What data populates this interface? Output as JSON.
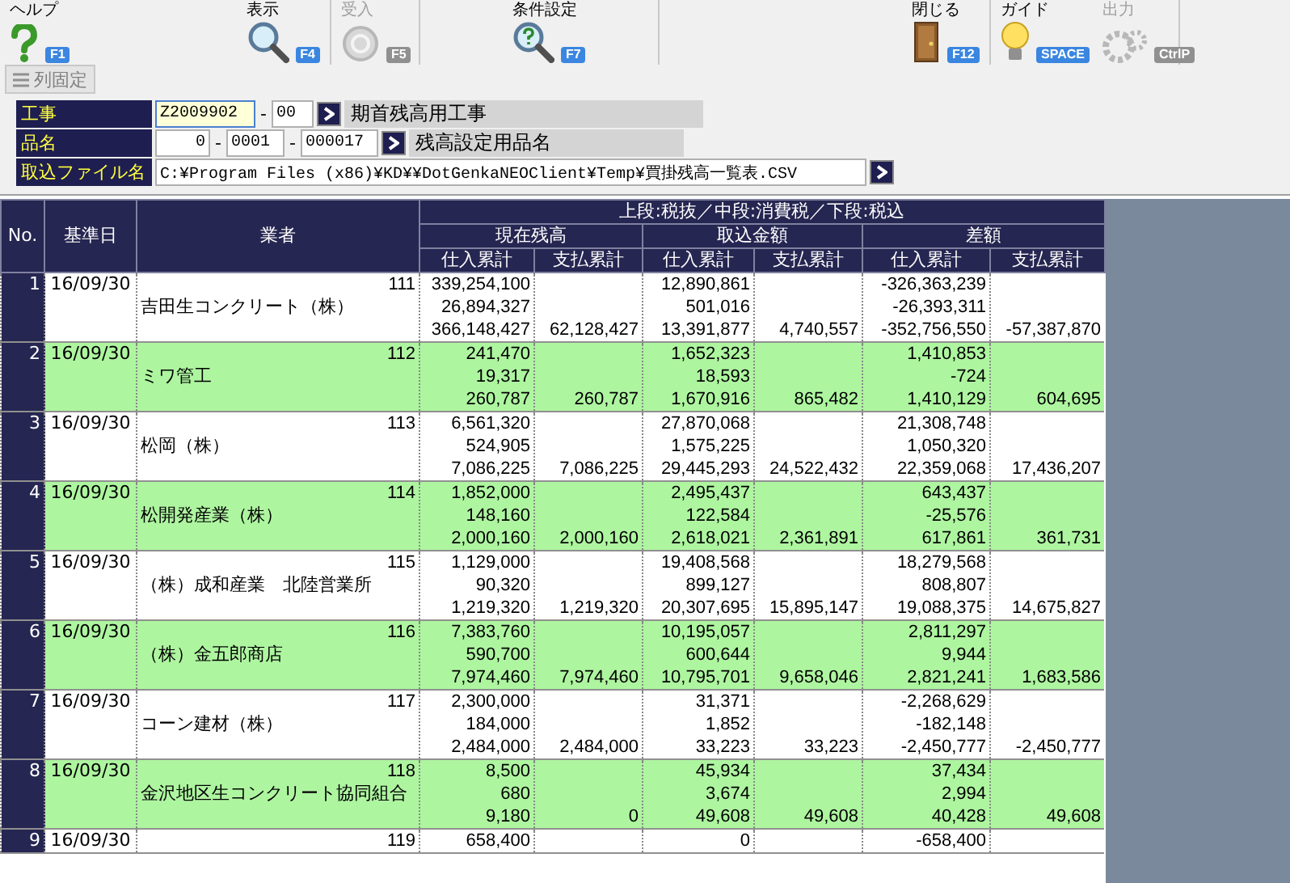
{
  "toolbar": {
    "groups": [
      {
        "items": [
          {
            "label": "ヘルプ",
            "key": "F1",
            "disabled": false
          },
          {
            "label": "表示",
            "key": "F4",
            "disabled": false
          }
        ]
      },
      {
        "items": [
          {
            "label": "受入",
            "key": "F5",
            "disabled": true
          }
        ]
      },
      {
        "items": [
          {
            "label": "条件設定",
            "key": "F7",
            "disabled": false
          }
        ]
      },
      {
        "items": [
          {
            "label": "閉じる",
            "key": "F12",
            "disabled": false
          }
        ]
      },
      {
        "items": [
          {
            "label": "ガイド",
            "key": "SPACE",
            "disabled": false
          },
          {
            "label": "出力",
            "key": "CtrlP",
            "disabled": true
          }
        ]
      }
    ]
  },
  "freeze_button": {
    "label": "列固定",
    "disabled": true
  },
  "filters": [
    {
      "label": "工事",
      "parts": [
        {
          "kind": "input",
          "value": "Z2009902",
          "focused": true
        },
        {
          "kind": "sep",
          "text": "-"
        },
        {
          "kind": "input",
          "value": "00",
          "focused": false
        },
        {
          "kind": "lookup"
        },
        {
          "kind": "display",
          "text": "期首残高用工事"
        }
      ]
    },
    {
      "label": "品名",
      "parts": [
        {
          "kind": "input",
          "value": "0",
          "focused": false
        },
        {
          "kind": "sep",
          "text": "-"
        },
        {
          "kind": "input",
          "value": "0001",
          "focused": false
        },
        {
          "kind": "sep",
          "text": "-"
        },
        {
          "kind": "input",
          "value": "000017",
          "focused": false
        },
        {
          "kind": "lookup"
        },
        {
          "kind": "display",
          "text": "残高設定用品名"
        }
      ]
    },
    {
      "label": "取込ファイル名",
      "parts": [
        {
          "kind": "input",
          "value": "C:¥Program Files (x86)¥KD¥¥DotGenkaNEOClient¥Temp¥買掛残高一覧表.CSV",
          "focused": false
        },
        {
          "kind": "lookup"
        }
      ]
    }
  ],
  "table": {
    "columns": {
      "no": "No.",
      "date": "基準日",
      "vendor": "業者",
      "tier_note": "上段:税抜／中段:消費税／下段:税込",
      "groups": [
        {
          "label": "現在残高",
          "sub": [
            "仕入累計",
            "支払累計"
          ]
        },
        {
          "label": "取込金額",
          "sub": [
            "仕入累計",
            "支払累計"
          ]
        },
        {
          "label": "差額",
          "sub": [
            "仕入累計",
            "支払累計"
          ]
        }
      ]
    },
    "rows": [
      {
        "no": "1",
        "date": "16/09/30",
        "code": "111",
        "name": "吉田生コンクリート（株）",
        "cells": [
          {
            "upper": "339,254,100",
            "middle": "26,894,327",
            "lower": "366,148,427"
          },
          {
            "lower": "62,128,427"
          },
          {
            "upper": "12,890,861",
            "middle": "501,016",
            "lower": "13,391,877"
          },
          {
            "lower": "4,740,557"
          },
          {
            "upper": "-326,363,239",
            "middle": "-26,393,311",
            "lower": "-352,756,550"
          },
          {
            "lower": "-57,387,870"
          }
        ]
      },
      {
        "no": "2",
        "date": "16/09/30",
        "code": "112",
        "name": "ミワ管工",
        "cells": [
          {
            "upper": "241,470",
            "middle": "19,317",
            "lower": "260,787"
          },
          {
            "lower": "260,787"
          },
          {
            "upper": "1,652,323",
            "middle": "18,593",
            "lower": "1,670,916"
          },
          {
            "lower": "865,482"
          },
          {
            "upper": "1,410,853",
            "middle": "-724",
            "lower": "1,410,129"
          },
          {
            "lower": "604,695"
          }
        ]
      },
      {
        "no": "3",
        "date": "16/09/30",
        "code": "113",
        "name": "松岡（株）",
        "cells": [
          {
            "upper": "6,561,320",
            "middle": "524,905",
            "lower": "7,086,225"
          },
          {
            "lower": "7,086,225"
          },
          {
            "upper": "27,870,068",
            "middle": "1,575,225",
            "lower": "29,445,293"
          },
          {
            "lower": "24,522,432"
          },
          {
            "upper": "21,308,748",
            "middle": "1,050,320",
            "lower": "22,359,068"
          },
          {
            "lower": "17,436,207"
          }
        ]
      },
      {
        "no": "4",
        "date": "16/09/30",
        "code": "114",
        "name": "松開発産業（株）",
        "cells": [
          {
            "upper": "1,852,000",
            "middle": "148,160",
            "lower": "2,000,160"
          },
          {
            "lower": "2,000,160"
          },
          {
            "upper": "2,495,437",
            "middle": "122,584",
            "lower": "2,618,021"
          },
          {
            "lower": "2,361,891"
          },
          {
            "upper": "643,437",
            "middle": "-25,576",
            "lower": "617,861"
          },
          {
            "lower": "361,731"
          }
        ]
      },
      {
        "no": "5",
        "date": "16/09/30",
        "code": "115",
        "name": "（株）成和産業　北陸営業所",
        "cells": [
          {
            "upper": "1,129,000",
            "middle": "90,320",
            "lower": "1,219,320"
          },
          {
            "lower": "1,219,320"
          },
          {
            "upper": "19,408,568",
            "middle": "899,127",
            "lower": "20,307,695"
          },
          {
            "lower": "15,895,147"
          },
          {
            "upper": "18,279,568",
            "middle": "808,807",
            "lower": "19,088,375"
          },
          {
            "lower": "14,675,827"
          }
        ]
      },
      {
        "no": "6",
        "date": "16/09/30",
        "code": "116",
        "name": "（株）金五郎商店",
        "cells": [
          {
            "upper": "7,383,760",
            "middle": "590,700",
            "lower": "7,974,460"
          },
          {
            "lower": "7,974,460"
          },
          {
            "upper": "10,195,057",
            "middle": "600,644",
            "lower": "10,795,701"
          },
          {
            "lower": "9,658,046"
          },
          {
            "upper": "2,811,297",
            "middle": "9,944",
            "lower": "2,821,241"
          },
          {
            "lower": "1,683,586"
          }
        ]
      },
      {
        "no": "7",
        "date": "16/09/30",
        "code": "117",
        "name": "コーン建材（株）",
        "cells": [
          {
            "upper": "2,300,000",
            "middle": "184,000",
            "lower": "2,484,000"
          },
          {
            "lower": "2,484,000"
          },
          {
            "upper": "31,371",
            "middle": "1,852",
            "lower": "33,223"
          },
          {
            "lower": "33,223"
          },
          {
            "upper": "-2,268,629",
            "middle": "-182,148",
            "lower": "-2,450,777"
          },
          {
            "lower": "-2,450,777"
          }
        ]
      },
      {
        "no": "8",
        "date": "16/09/30",
        "code": "118",
        "name": "金沢地区生コンクリート協同組合",
        "cells": [
          {
            "upper": "8,500",
            "middle": "680",
            "lower": "9,180"
          },
          {
            "lower": "0"
          },
          {
            "upper": "45,934",
            "middle": "3,674",
            "lower": "49,608"
          },
          {
            "lower": "49,608"
          },
          {
            "upper": "37,434",
            "middle": "2,994",
            "lower": "40,428"
          },
          {
            "lower": "49,608"
          }
        ]
      },
      {
        "no": "9",
        "date": "16/09/30",
        "code": "119",
        "cells": [
          {
            "upper": "658,400"
          },
          {},
          {
            "upper": "0"
          },
          {},
          {
            "upper": "-658,400"
          },
          {}
        ]
      }
    ]
  }
}
